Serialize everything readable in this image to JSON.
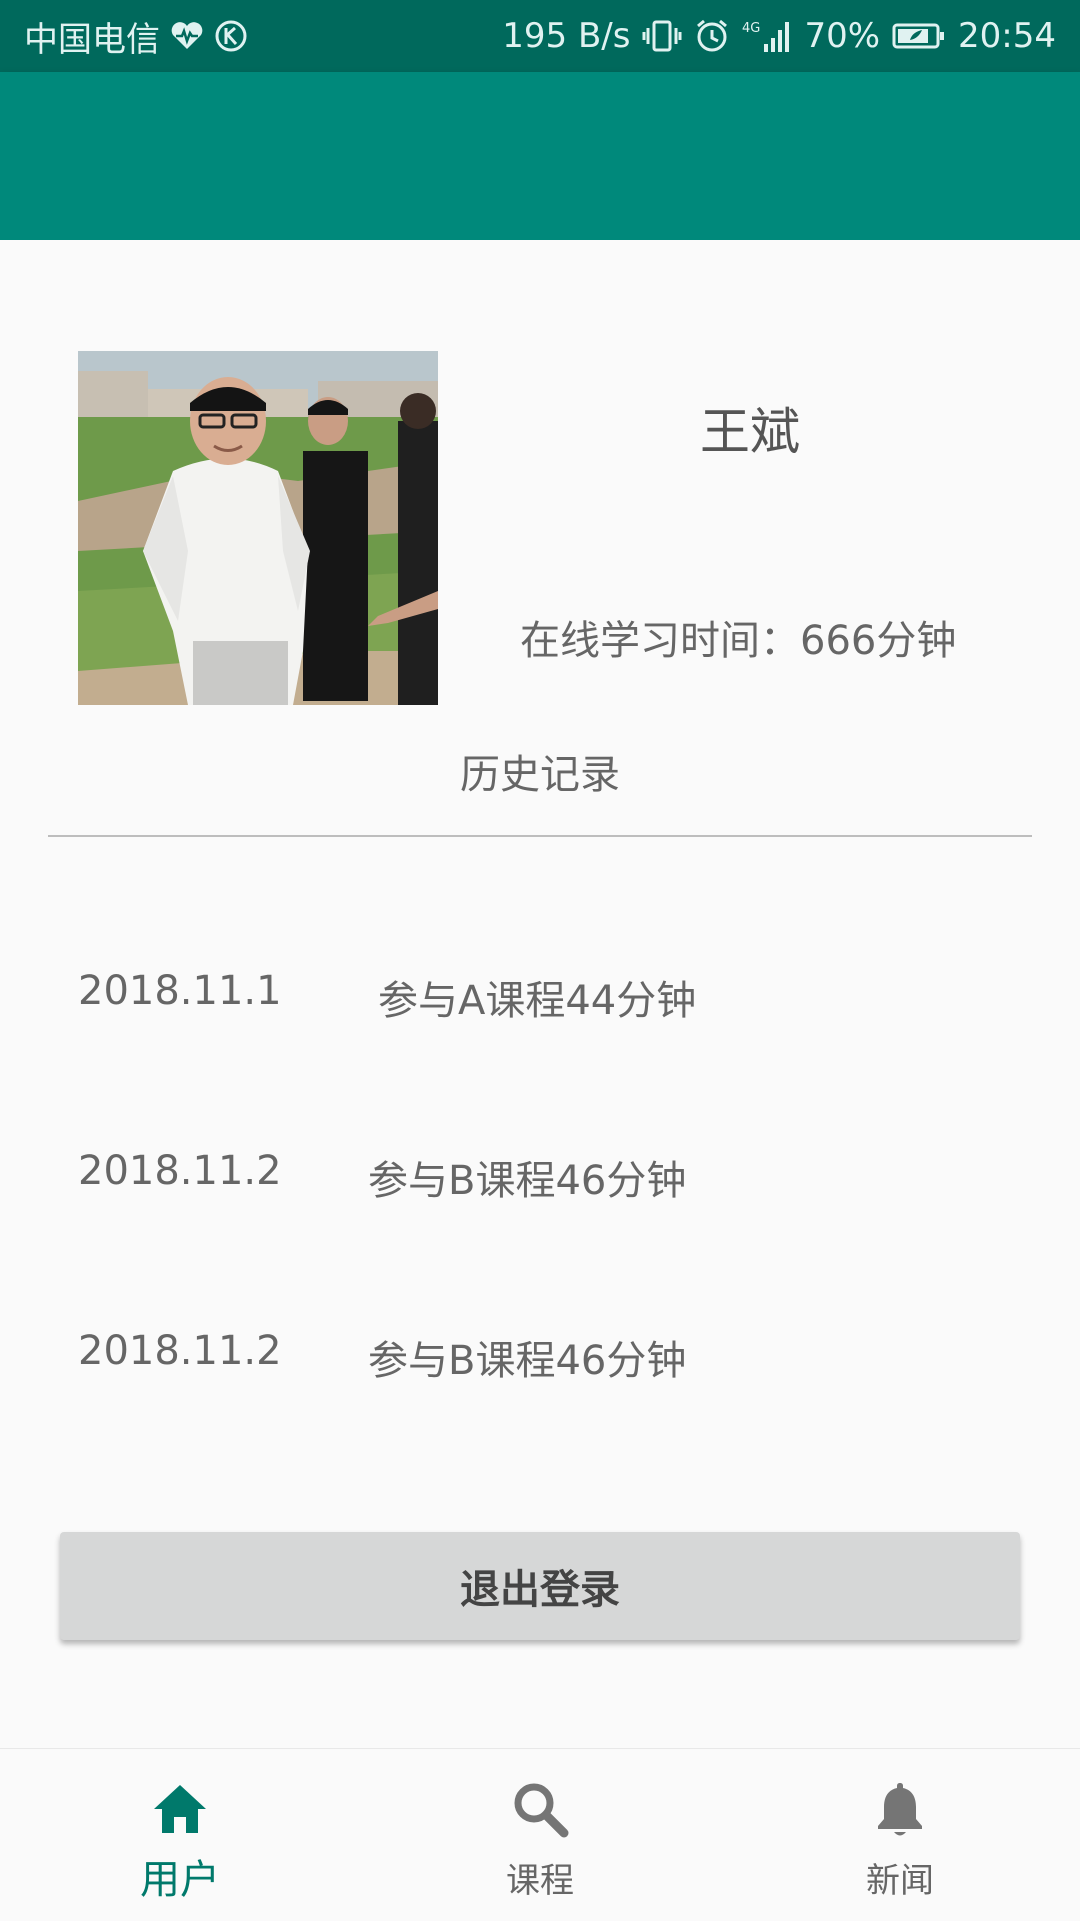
{
  "status_bar": {
    "carrier": "中国电信",
    "net_speed": "195 B/s",
    "network_type": "4G",
    "battery": "70%",
    "time": "20:54",
    "icons": [
      "heart-rate-icon",
      "k-circle-icon",
      "vibrate-icon",
      "alarm-icon",
      "signal-icon",
      "battery-icon"
    ]
  },
  "profile": {
    "name": "王斌",
    "online_time": "在线学习时间：666分钟"
  },
  "history": {
    "title": "历史记录",
    "items": [
      {
        "date": "2018.11.1",
        "desc": "参与A课程44分钟"
      },
      {
        "date": "2018.11.2",
        "desc": "参与B课程46分钟"
      },
      {
        "date": "2018.11.2",
        "desc": "参与B课程46分钟"
      }
    ]
  },
  "logout": {
    "label": "退出登录"
  },
  "bottom_nav": {
    "items": [
      {
        "label": "用户",
        "icon": "home-icon",
        "active": true
      },
      {
        "label": "课程",
        "icon": "search-icon",
        "active": false
      },
      {
        "label": "新闻",
        "icon": "bell-icon",
        "active": false
      }
    ]
  },
  "colors": {
    "status_bar": "#00695c",
    "app_bar": "#00897b",
    "accent": "#00796b",
    "text": "#666666",
    "button_bg": "#d6d7d7"
  }
}
